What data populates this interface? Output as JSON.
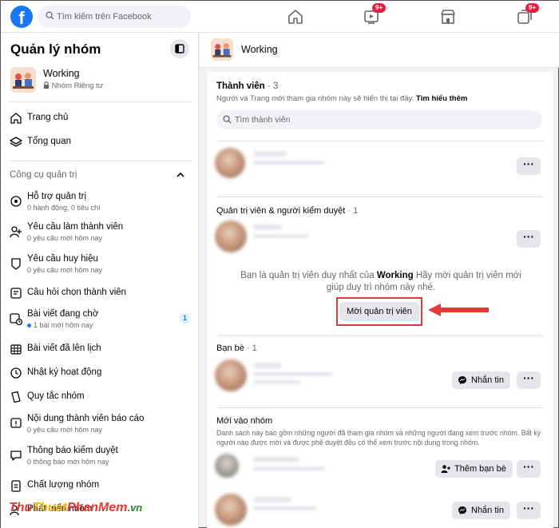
{
  "topbar": {
    "logo": "f",
    "search_placeholder": "Tìm kiếm trên Facebook",
    "watch_badge": "9+",
    "groups_badge": "9+"
  },
  "sidebar": {
    "title": "Quản lý nhóm",
    "group_name": "Working",
    "group_privacy": "Nhóm Riêng tư",
    "nav": [
      {
        "label": "Trang chủ",
        "icon": "home-icon"
      },
      {
        "label": "Tổng quan",
        "icon": "layers-icon"
      }
    ],
    "admin_tools_label": "Công cụ quản trị",
    "tools": [
      {
        "label": "Hỗ trợ quản trị",
        "sub": "0 hành động, 0 tiêu chí"
      },
      {
        "label": "Yêu cầu làm thành viên",
        "sub": "0 yêu cầu mới hôm nay"
      },
      {
        "label": "Yêu cầu huy hiệu",
        "sub": "0 yêu cầu mới hôm nay"
      },
      {
        "label": "Câu hỏi chọn thành viên",
        "sub": ""
      },
      {
        "label": "Bài viết đang chờ",
        "sub": "1 bài mới hôm nay",
        "count": "1"
      },
      {
        "label": "Bài viết đã lên lịch",
        "sub": ""
      },
      {
        "label": "Nhật ký hoạt động",
        "sub": ""
      },
      {
        "label": "Quy tắc nhóm",
        "sub": ""
      },
      {
        "label": "Nội dung thành viên báo cáo",
        "sub": "0 yêu cầu mới hôm nay"
      },
      {
        "label": "Thông báo kiểm duyệt",
        "sub": "0 thông báo mới hôm nay"
      },
      {
        "label": "Chất lượng nhóm",
        "sub": ""
      },
      {
        "label": "Phát triển nhóm",
        "sub": ""
      }
    ]
  },
  "main": {
    "header_title": "Working",
    "members": {
      "heading": "Thành viên",
      "count": "· 3",
      "description": "Người và Trang mới tham gia nhóm này sẽ hiển thị tại đây.",
      "learn_more": "Tìm hiểu thêm",
      "search_placeholder": "Tìm thành viên"
    },
    "admins": {
      "heading": "Quản trị viên & người kiểm duyệt",
      "count": "· 1",
      "message_pre": "Bạn là quản trị viên duy nhất của",
      "message_group": "Working",
      "message_post": "Hãy mời quản trị viên mới giúp duy trì nhóm này nhé.",
      "invite_button": "Mời quản trị viên"
    },
    "friends": {
      "heading": "Bạn bè",
      "count": "· 1",
      "message_button": "Nhắn tin"
    },
    "new_members": {
      "heading": "Mới vào nhóm",
      "description": "Danh sách này bao gồm những người đã tham gia nhóm và những người đang xem trước nhóm. Bất kỳ người nào được mời và được phê duyệt đều có thể xem trước nội dung trong nhóm.",
      "add_friend_button": "Thêm bạn bè",
      "message_button": "Nhắn tin"
    },
    "more_label": "···"
  },
  "watermark": {
    "a": "Thu",
    "b": "Thuat",
    "c": "PhanMem",
    "d": ".vn"
  },
  "colors": {
    "brand": "#1877f2",
    "highlight": "#e53935",
    "badge": "#e41e3f"
  }
}
